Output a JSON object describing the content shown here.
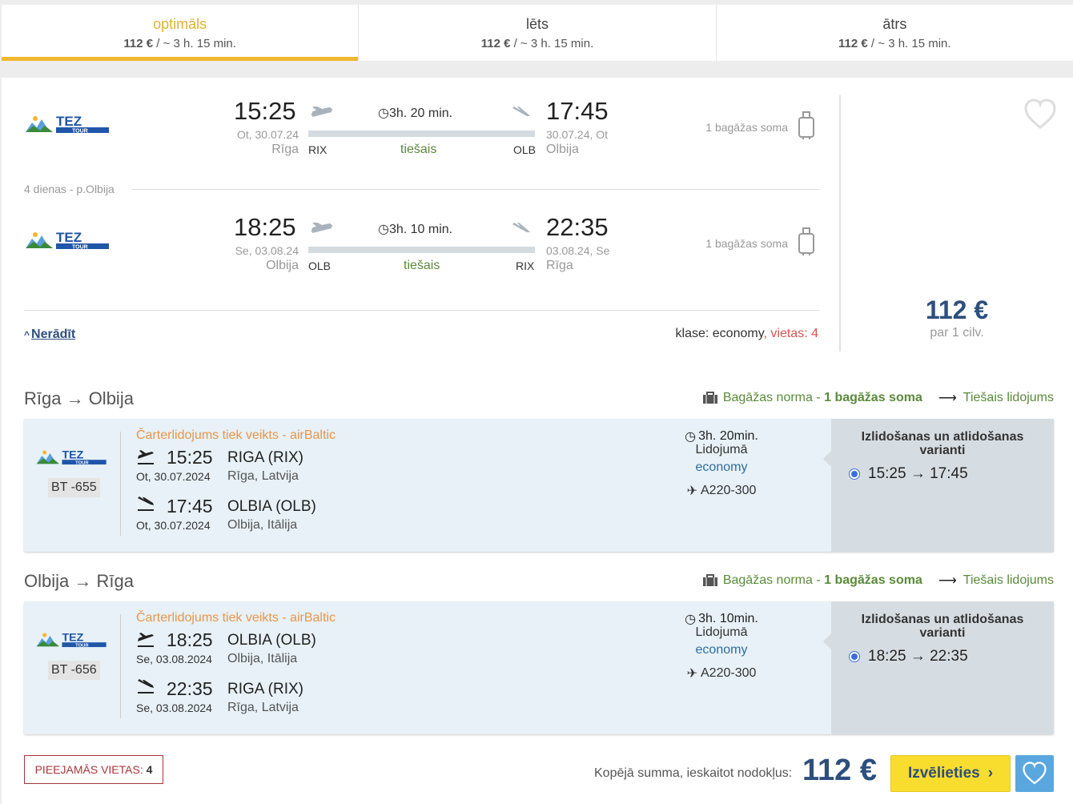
{
  "tabs": [
    {
      "label": "optimāls",
      "price": "112 €",
      "info": " / ~ 3 h. 15 min."
    },
    {
      "label": "lēts",
      "price": "112 €",
      "info": " / ~ 3 h. 15 min."
    },
    {
      "label": "ātrs",
      "price": "112 €",
      "info": " / ~ 3 h. 15 min."
    }
  ],
  "summary": {
    "outbound": {
      "dep_time": "15:25",
      "dep_date": "Ot, 30.07.24",
      "dep_city": "Rīga",
      "dep_code": "RIX",
      "duration": "3h. 20 min.",
      "direct": "tiešais",
      "arr_time": "17:45",
      "arr_date": "30.07.24, Ot",
      "arr_city": "Olbija",
      "arr_code": "OLB",
      "baggage": "1 bagāžas soma"
    },
    "stay": "4 dienas - p.Olbija",
    "inbound": {
      "dep_time": "18:25",
      "dep_date": "Se, 03.08.24",
      "dep_city": "Olbija",
      "dep_code": "OLB",
      "duration": "3h. 10 min.",
      "direct": "tiešais",
      "arr_time": "22:35",
      "arr_date": "03.08.24, Se",
      "arr_city": "Rīga",
      "arr_code": "RIX",
      "baggage": "1 bagāžas soma"
    },
    "hide_label": "Nerādīt",
    "class_label": "klase: economy",
    "seats_label": ", vietas: 4",
    "price": "112 €",
    "price_per": "par 1 cilv."
  },
  "logo_text": "TEZ",
  "logo_sub": "TOUR",
  "details": [
    {
      "route": "Rīga → Olbija",
      "baggage_prefix": "Bagāžas norma - ",
      "baggage_value": "1 bagāžas soma",
      "direct_flight": "Tiešais lidojums",
      "flight_no": "BT -655",
      "charter": "Čarterlidojums tiek veikts - airBaltic",
      "dep_time": "15:25",
      "dep_airport": "RIGA (RIX)",
      "dep_date": "Ot, 30.07.2024",
      "dep_city": "Rīga, Latvija",
      "arr_time": "17:45",
      "arr_airport": "OLBIA (OLB)",
      "arr_date": "Ot, 30.07.2024",
      "arr_city": "Olbija, Itālija",
      "duration": "3h. 20min.",
      "duration_label": "Lidojumā",
      "class": "economy",
      "aircraft": "A220-300",
      "options_title": "Izlidošanas un atlidošanas varianti",
      "option": "15:25 → 17:45"
    },
    {
      "route": "Olbija → Rīga",
      "baggage_prefix": "Bagāžas norma - ",
      "baggage_value": "1 bagāžas soma",
      "direct_flight": "Tiešais lidojums",
      "flight_no": "BT -656",
      "charter": "Čarterlidojums tiek veikts - airBaltic",
      "dep_time": "18:25",
      "dep_airport": "OLBIA (OLB)",
      "dep_date": "Se, 03.08.2024",
      "dep_city": "Olbija, Itālija",
      "arr_time": "22:35",
      "arr_airport": "RIGA (RIX)",
      "arr_date": "Se, 03.08.2024",
      "arr_city": "Rīga, Latvija",
      "duration": "3h. 10min.",
      "duration_label": "Lidojumā",
      "class": "economy",
      "aircraft": "A220-300",
      "options_title": "Izlidošanas un atlidošanas varianti",
      "option": "18:25 → 22:35"
    }
  ],
  "footer": {
    "seats_label": "PIEEJAMĀS VIETAS: ",
    "seats_value": "4",
    "total_label": "Kopējā summa, ieskaitot nodokļus:",
    "total_value": "112 €",
    "select_label": "Izvēlieties"
  },
  "colors": {
    "accent": "#f0b62c",
    "brand": "#2d4f7d",
    "green": "#5a8a3a",
    "button": "#f8dc2e"
  }
}
